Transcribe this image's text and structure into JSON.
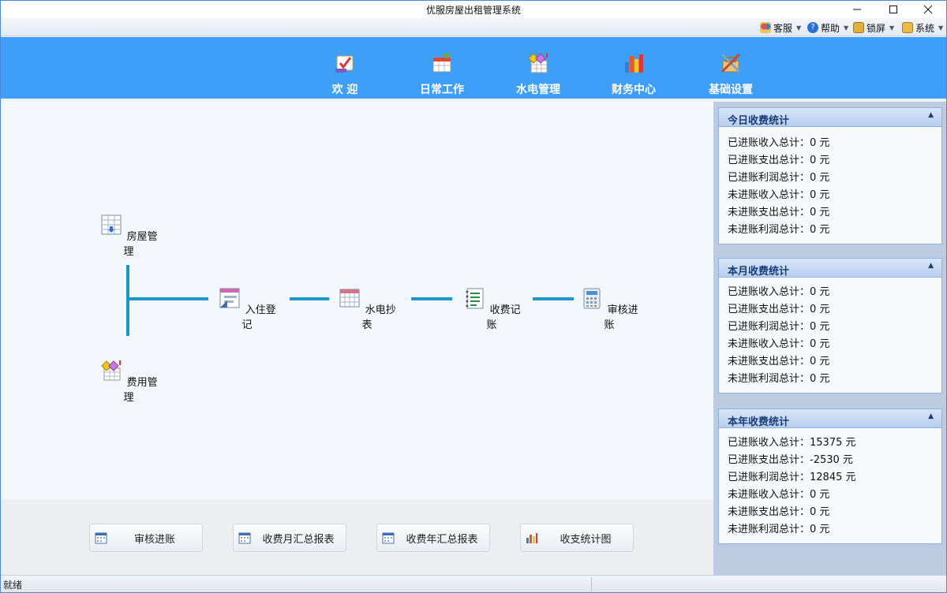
{
  "window": {
    "title": "优服房屋出租管理系统"
  },
  "menu": [
    {
      "label": "客服",
      "icon": "users-icon"
    },
    {
      "label": "帮助",
      "icon": "help-icon"
    },
    {
      "label": "锁屏",
      "icon": "lock-screen-icon"
    },
    {
      "label": "系统",
      "icon": "lock-icon"
    }
  ],
  "nav": [
    {
      "label": "欢 迎",
      "icon": "welcome-icon"
    },
    {
      "label": "日常工作",
      "icon": "calendar-icon"
    },
    {
      "label": "水电管理",
      "icon": "meter-icon"
    },
    {
      "label": "财务中心",
      "icon": "bar-chart-icon"
    },
    {
      "label": "基础设置",
      "icon": "tools-icon"
    }
  ],
  "flow": {
    "house": "房屋管理",
    "fee": "费用管理",
    "checkin": "入住登记",
    "meter": "水电抄表",
    "charge": "收费记账",
    "audit": "审核进账"
  },
  "buttons": [
    "审核进账",
    "收费月汇总报表",
    "收费年汇总报表",
    "收支统计图"
  ],
  "panels": [
    {
      "title": "今日收费统计",
      "rows": [
        "已进账收入总计：0 元",
        "已进账支出总计：0 元",
        "已进账利润总计：0 元",
        "未进账收入总计：0 元",
        "未进账支出总计：0 元",
        "未进账利润总计：0 元"
      ]
    },
    {
      "title": "本月收费统计",
      "rows": [
        "已进账收入总计：0 元",
        "已进账支出总计：0 元",
        "已进账利润总计：0 元",
        "未进账收入总计：0 元",
        "未进账支出总计：0 元",
        "未进账利润总计：0 元"
      ]
    },
    {
      "title": "本年收费统计",
      "rows": [
        "已进账收入总计：15375 元",
        "已进账支出总计：-2530 元",
        "已进账利润总计：12845 元",
        "未进账收入总计：0 元",
        "未进账支出总计：0 元",
        "未进账利润总计：0 元"
      ]
    }
  ],
  "status": {
    "text": "就绪"
  },
  "colors": {
    "nav_bg": "#3d9ff7",
    "flow_line": "#1c98c8",
    "panel_title": "#1b3d78"
  }
}
